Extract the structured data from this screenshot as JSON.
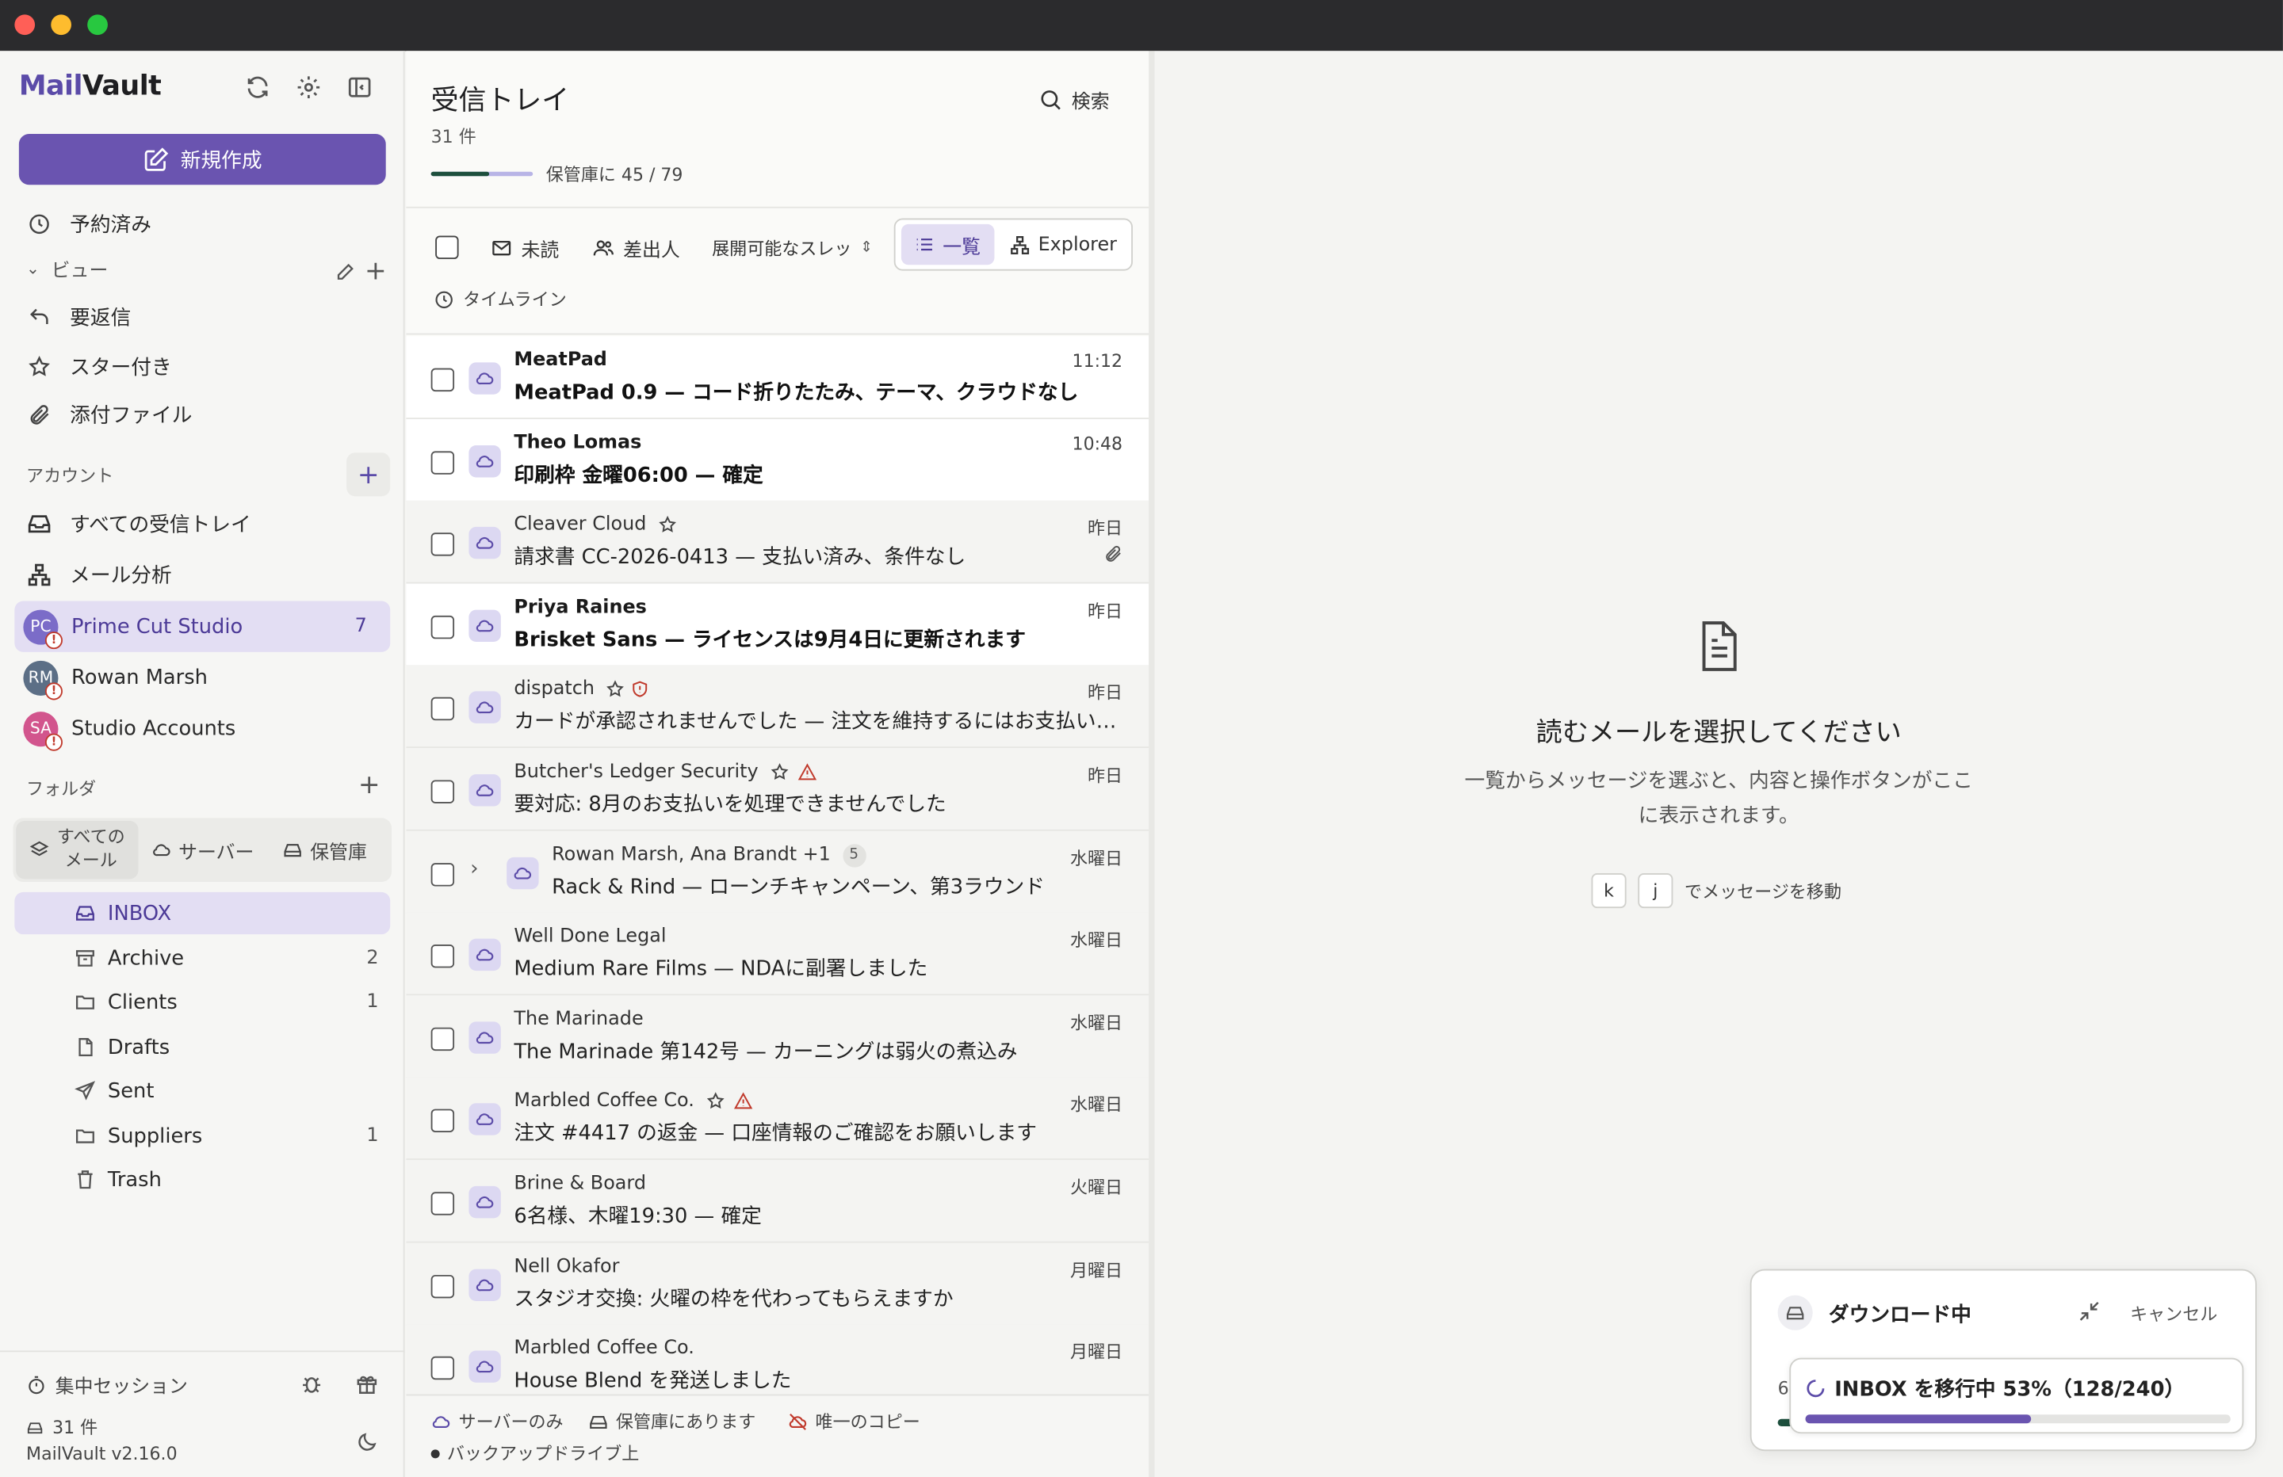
{
  "app": {
    "name_prefix": "Mail",
    "name_suffix": "Vault",
    "version": "MailVault v2.16.0"
  },
  "colors": {
    "accent": "#6a54b0",
    "accent_bg": "#e3def3",
    "progress_dark": "#1d4f3d"
  },
  "sidebar": {
    "compose_label": "新規作成",
    "scheduled_label": "予約済み",
    "views_label": "ビュー",
    "views": [
      {
        "label": "要返信",
        "icon": "reply-icon"
      },
      {
        "label": "スター付き",
        "icon": "star-icon"
      },
      {
        "label": "添付ファイル",
        "icon": "paperclip-icon"
      }
    ],
    "accounts_label": "アカウント",
    "all_inbox_label": "すべての受信トレイ",
    "analytics_label": "メール分析",
    "accounts": [
      {
        "initials": "PC",
        "name": "Prime Cut Studio",
        "count": "7",
        "color": "#7b6cc8"
      },
      {
        "initials": "RM",
        "name": "Rowan Marsh",
        "count": "",
        "color": "#5c6f86"
      },
      {
        "initials": "SA",
        "name": "Studio Accounts",
        "count": "",
        "color": "#d2558d"
      }
    ],
    "folders_label": "フォルダ",
    "scope": {
      "all": "すべての\nメール",
      "server": "サーバー",
      "vault": "保管庫"
    },
    "folders": [
      {
        "name": "INBOX",
        "count": "",
        "icon": "inbox-icon"
      },
      {
        "name": "Archive",
        "count": "2",
        "icon": "archive-icon"
      },
      {
        "name": "Clients",
        "count": "1",
        "icon": "folder-icon"
      },
      {
        "name": "Drafts",
        "count": "",
        "icon": "draft-icon"
      },
      {
        "name": "Sent",
        "count": "",
        "icon": "send-icon"
      },
      {
        "name": "Suppliers",
        "count": "1",
        "icon": "folder-icon"
      },
      {
        "name": "Trash",
        "count": "",
        "icon": "trash-icon"
      }
    ],
    "focus_label": "集中セッション",
    "count_label": "31 件"
  },
  "list": {
    "title": "受信トレイ",
    "count": "31 件",
    "vault_progress_text": "保管庫に 45 / 79",
    "vault_progress": 0.57,
    "search_label": "検索",
    "filters": {
      "unread": "未読",
      "sender": "差出人",
      "threads": "展開可能なスレッ"
    },
    "view_list": "一覧",
    "view_explorer": "Explorer",
    "timeline_label": "タイムライン",
    "messages": [
      {
        "sender": "MeatPad",
        "subject": "MeatPad 0.9 — コード折りたたみ、テーマ、クラウドなし",
        "time": "11:12",
        "unread": true
      },
      {
        "sender": "Theo Lomas",
        "subject": "印刷枠 金曜06:00 — 確定",
        "time": "10:48",
        "unread": true
      },
      {
        "sender": "Cleaver Cloud",
        "subject": "請求書 CC-2026-0413 — 支払い済み、条件なし",
        "time": "昨日",
        "unread": false,
        "star": true,
        "attachment": true
      },
      {
        "sender": "Priya Raines",
        "subject": "Brisket Sans — ライセンスは9月4日に更新されます",
        "time": "昨日",
        "unread": true
      },
      {
        "sender": "dispatch",
        "subject": "カードが承認されませんでした — 注文を維持するにはお支払い情報を更新してください",
        "time": "昨日",
        "unread": false,
        "star": true,
        "shield": true
      },
      {
        "sender": "Butcher's Ledger Security",
        "subject": "要対応: 8月のお支払いを処理できませんでした",
        "time": "昨日",
        "unread": false,
        "star": true,
        "warning": true
      },
      {
        "sender": "Rowan Marsh, Ana Brandt +1",
        "subject": "Rack & Rind — ローンチキャンペーン、第3ラウンド",
        "time": "水曜日",
        "unread": false,
        "thread": "5"
      },
      {
        "sender": "Well Done Legal",
        "subject": "Medium Rare Films — NDAに副署しました",
        "time": "水曜日",
        "unread": false
      },
      {
        "sender": "The Marinade",
        "subject": "The Marinade 第142号 — カーニングは弱火の煮込み",
        "time": "水曜日",
        "unread": false
      },
      {
        "sender": "Marbled Coffee Co.",
        "subject": "注文 #4417 の返金 — 口座情報のご確認をお願いします",
        "time": "水曜日",
        "unread": false,
        "star": true,
        "warning": true
      },
      {
        "sender": "Brine & Board",
        "subject": "6名様、木曜19:30 — 確定",
        "time": "火曜日",
        "unread": false
      },
      {
        "sender": "Nell Okafor",
        "subject": "スタジオ交換: 火曜の枠を代わってもらえますか",
        "time": "月曜日",
        "unread": false
      },
      {
        "sender": "Marbled Coffee Co.",
        "subject": "House Blend を発送しました",
        "time": "月曜日",
        "unread": false
      }
    ],
    "legend": {
      "server_only": "サーバーのみ",
      "in_vault": "保管庫にあります",
      "only_copy": "唯一のコピー",
      "backup": "バックアップドライブ上"
    }
  },
  "reading": {
    "empty_title": "読むメールを選択してください",
    "empty_desc": "一覧からメッセージを選ぶと、内容と操作ボタンがここに表示されます。",
    "key_k": "k",
    "key_j": "j",
    "key_hint": "でメッセージを移動"
  },
  "download": {
    "title": "ダウンロード中",
    "cancel": "キャンセル",
    "behind_text": "6",
    "task_text": "INBOX を移行中 53%（128/240）",
    "progress": 0.53
  }
}
